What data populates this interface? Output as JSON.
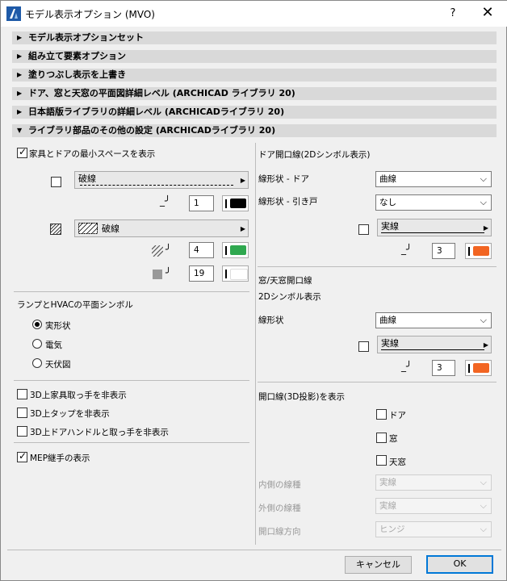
{
  "window": {
    "title": "モデル表示オプション (MVO)",
    "help": "?",
    "close": "✕"
  },
  "sections": [
    {
      "label": "モデル表示オプションセット",
      "tri": "▶"
    },
    {
      "label": "組み立て要素オプション",
      "tri": "▶"
    },
    {
      "label": "塗りつぶし表示を上書き",
      "tri": "▶"
    },
    {
      "label": "ドア、窓と天窓の平面図詳細レベル (ARCHICAD ライブラリ 20)",
      "tri": "▶"
    },
    {
      "label": "日本語版ライブラリの詳細レベル (ARCHICADライブラリ 20)",
      "tri": "▶"
    },
    {
      "label": "ライブラリ部品のその他の設定 (ARCHICADライブラリ 20)",
      "tri": "▼"
    }
  ],
  "left": {
    "furniture_space": {
      "label": "家具とドアの最小スペースを表示",
      "checked": true
    },
    "line_type1": "破線",
    "pen1": "1",
    "fill_type": "破線",
    "fill_pen": "4",
    "bg_pen": "19",
    "lamp_title": "ランプとHVACの平面シンボル",
    "radios": [
      "実形状",
      "電気",
      "天伏図"
    ],
    "hide_furniture_handles": "3D上家具取っ手を非表示",
    "hide_taps": "3D上タップを非表示",
    "hide_door_handles": "3D上ドアハンドルと取っ手を非表示",
    "mep": "MEP継手の表示"
  },
  "right": {
    "door_title": "ドア開口線(2Dシンボル表示)",
    "door_shape_label": "線形状 - ドア",
    "door_shape_value": "曲線",
    "sliding_label": "線形状 - 引き戸",
    "sliding_value": "なし",
    "door_line_type": "実線",
    "door_pen": "3",
    "window_title": "窓/天窓開口線",
    "window_sub": "2Dシンボル表示",
    "window_shape_label": "線形状",
    "window_shape_value": "曲線",
    "window_line_type": "実線",
    "window_pen": "3",
    "opening3d_title": "開口線(3D投影)を表示",
    "opening3d_items": [
      "ドア",
      "窓",
      "天窓"
    ],
    "inner_label": "内側の線種",
    "inner_value": "実線",
    "outer_label": "外側の線種",
    "outer_value": "実線",
    "dir_label": "開口線方向",
    "dir_value": "ヒンジ"
  },
  "buttons": {
    "cancel": "キャンセル",
    "ok": "OK"
  },
  "colors": {
    "black": "#000000",
    "green": "#2fa84f",
    "white": "#ffffff",
    "orange": "#f26522",
    "accent": "#0078d7"
  }
}
